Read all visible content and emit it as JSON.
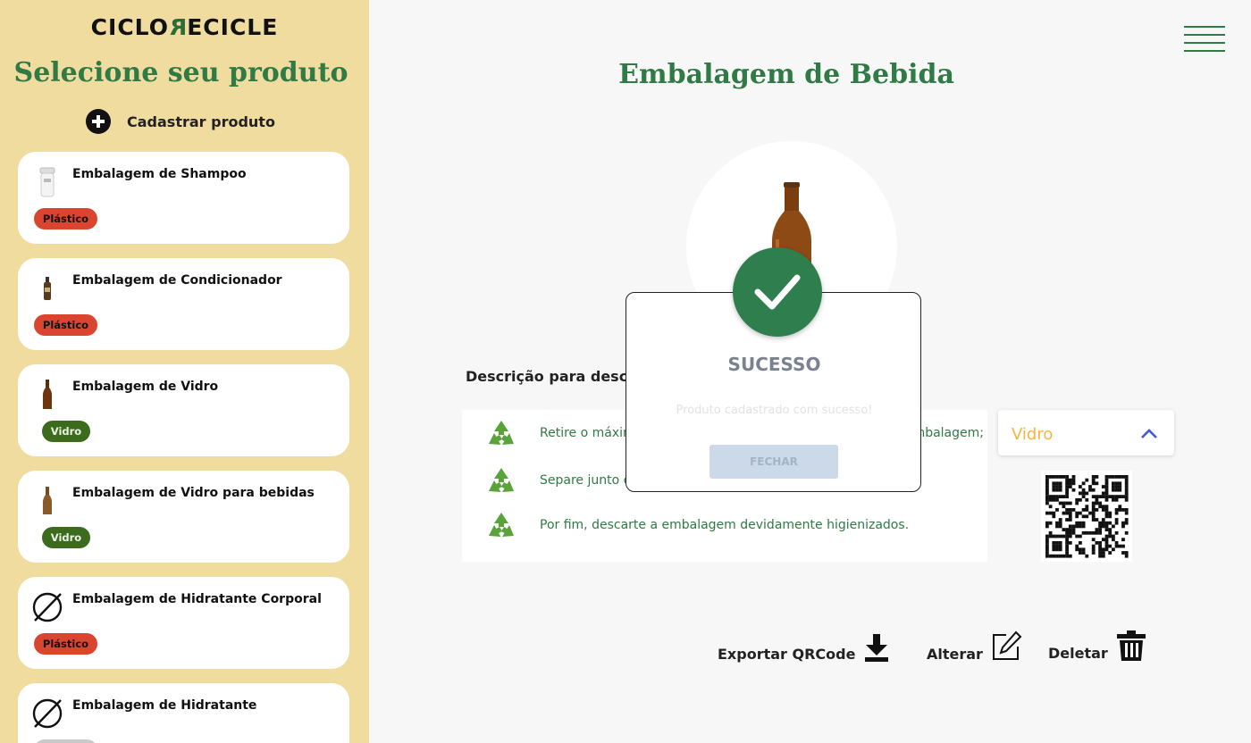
{
  "sidebar": {
    "logo": {
      "part1": "CICLO",
      "part2": "R",
      "part3": "ECICLE"
    },
    "title": "Selecione seu produto",
    "add_label": "Cadastrar produto",
    "items": [
      {
        "name": "Embalagem de Shampoo",
        "tag": "Plástico",
        "icon": "shampoo-bottle"
      },
      {
        "name": "Embalagem de Condicionador",
        "tag": "Plástico",
        "icon": "conditioner-bottle"
      },
      {
        "name": "Embalagem de Vidro",
        "tag": "Vidro",
        "icon": "glass-bottle"
      },
      {
        "name": "Embalagem de Vidro para bebidas",
        "tag": "Vidro",
        "icon": "glass-bottle"
      },
      {
        "name": "Embalagem de Hidratante Corporal",
        "tag": "Plástico",
        "icon": "no-image-icon"
      },
      {
        "name": "Embalagem de Hidratante",
        "tag": "",
        "icon": "no-image-icon"
      }
    ]
  },
  "main": {
    "title": "Embalagem de Bebida",
    "description_title": "Descrição para descarte",
    "steps": [
      {
        "text_left": "Retire o máximo",
        "text_right": "embalagem;"
      },
      {
        "text_left": "Separe junto c",
        "text_right": ""
      },
      {
        "text_left": "Por fim, descarte a embalagem devidamente higienizados.",
        "text_right": ""
      }
    ],
    "material_select": {
      "value": "Vidro"
    },
    "actions": {
      "export": "Exportar QRCode",
      "edit": "Alterar",
      "delete": "Deletar"
    }
  },
  "modal": {
    "title": "SUCESSO",
    "message": "Produto cadastrado com sucesso!",
    "button": "FECHAR"
  },
  "colors": {
    "sidebar_bg": "#f1dc9f",
    "brand_green": "#2f7a45",
    "tag_plastico": "#d9452f",
    "tag_vidro": "#3c6b1e",
    "select_value": "#f5b53a"
  }
}
